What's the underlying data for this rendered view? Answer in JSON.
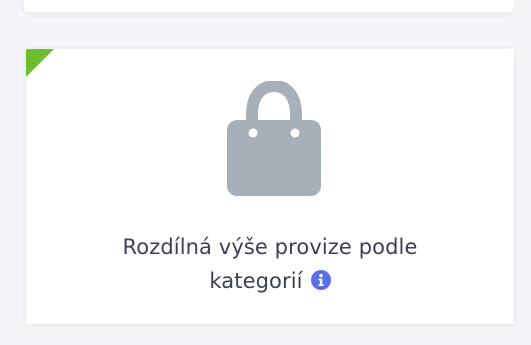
{
  "card": {
    "title_line1": "Rozdílná výše provize podle",
    "title_line2": "kategorií",
    "icon": "shopping-bag-icon",
    "info_icon": "info-icon",
    "colors": {
      "corner_flag": "#6dbf2f",
      "icon_gray": "#a7afb9",
      "info_blue": "#5b6ee8",
      "text": "#3a4150"
    }
  }
}
